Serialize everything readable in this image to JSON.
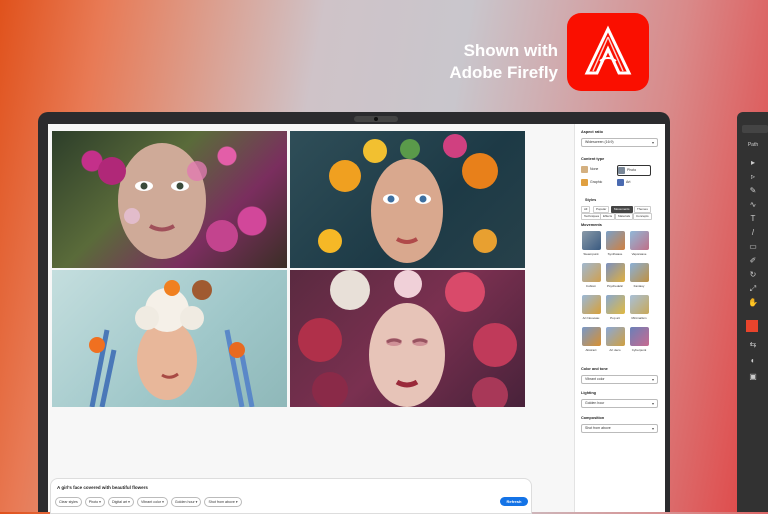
{
  "promo": {
    "line1": "Shown with",
    "line2": "Adobe Firefly",
    "brand_color": "#fa0f00"
  },
  "prompt": {
    "text": "A girl's face covered with beautiful flowers",
    "chips": [
      "Clear styles",
      "Photo ▾",
      "Digital art ▾",
      "Vibrant color ▾",
      "Golden hour ▾",
      "Shot from above ▾"
    ],
    "refresh_label": "Refresh",
    "refresh_color": "#1473e6"
  },
  "panel": {
    "aspect_ratio_title": "Aspect ratio",
    "aspect_ratio_value": "Widescreen (16:9)",
    "content_type_title": "Content type",
    "content_types": [
      "None",
      "Photo",
      "Graphic",
      "Art"
    ],
    "styles_title": "Styles",
    "style_tabs": [
      "All",
      "Popular",
      "Movements",
      "Themes",
      "Techniques",
      "Effects",
      "Materials",
      "Concepts"
    ],
    "movements_title": "Movements",
    "movements": [
      "Steampunk",
      "Synthwave",
      "Vaporwave",
      "Cubism",
      "Psychedelic",
      "Fantasy",
      "Art Nouveau",
      "Pop art",
      "Minimalism",
      "Abstract",
      "Art deco",
      "Cyberpunk"
    ],
    "color_title": "Color and tone",
    "color_value": "Vibrant color",
    "lighting_title": "Lighting",
    "lighting_value": "Golden hour",
    "composition_title": "Composition",
    "composition_value": "Shot from above"
  },
  "ghost_app": {
    "tab_label": "Path"
  }
}
